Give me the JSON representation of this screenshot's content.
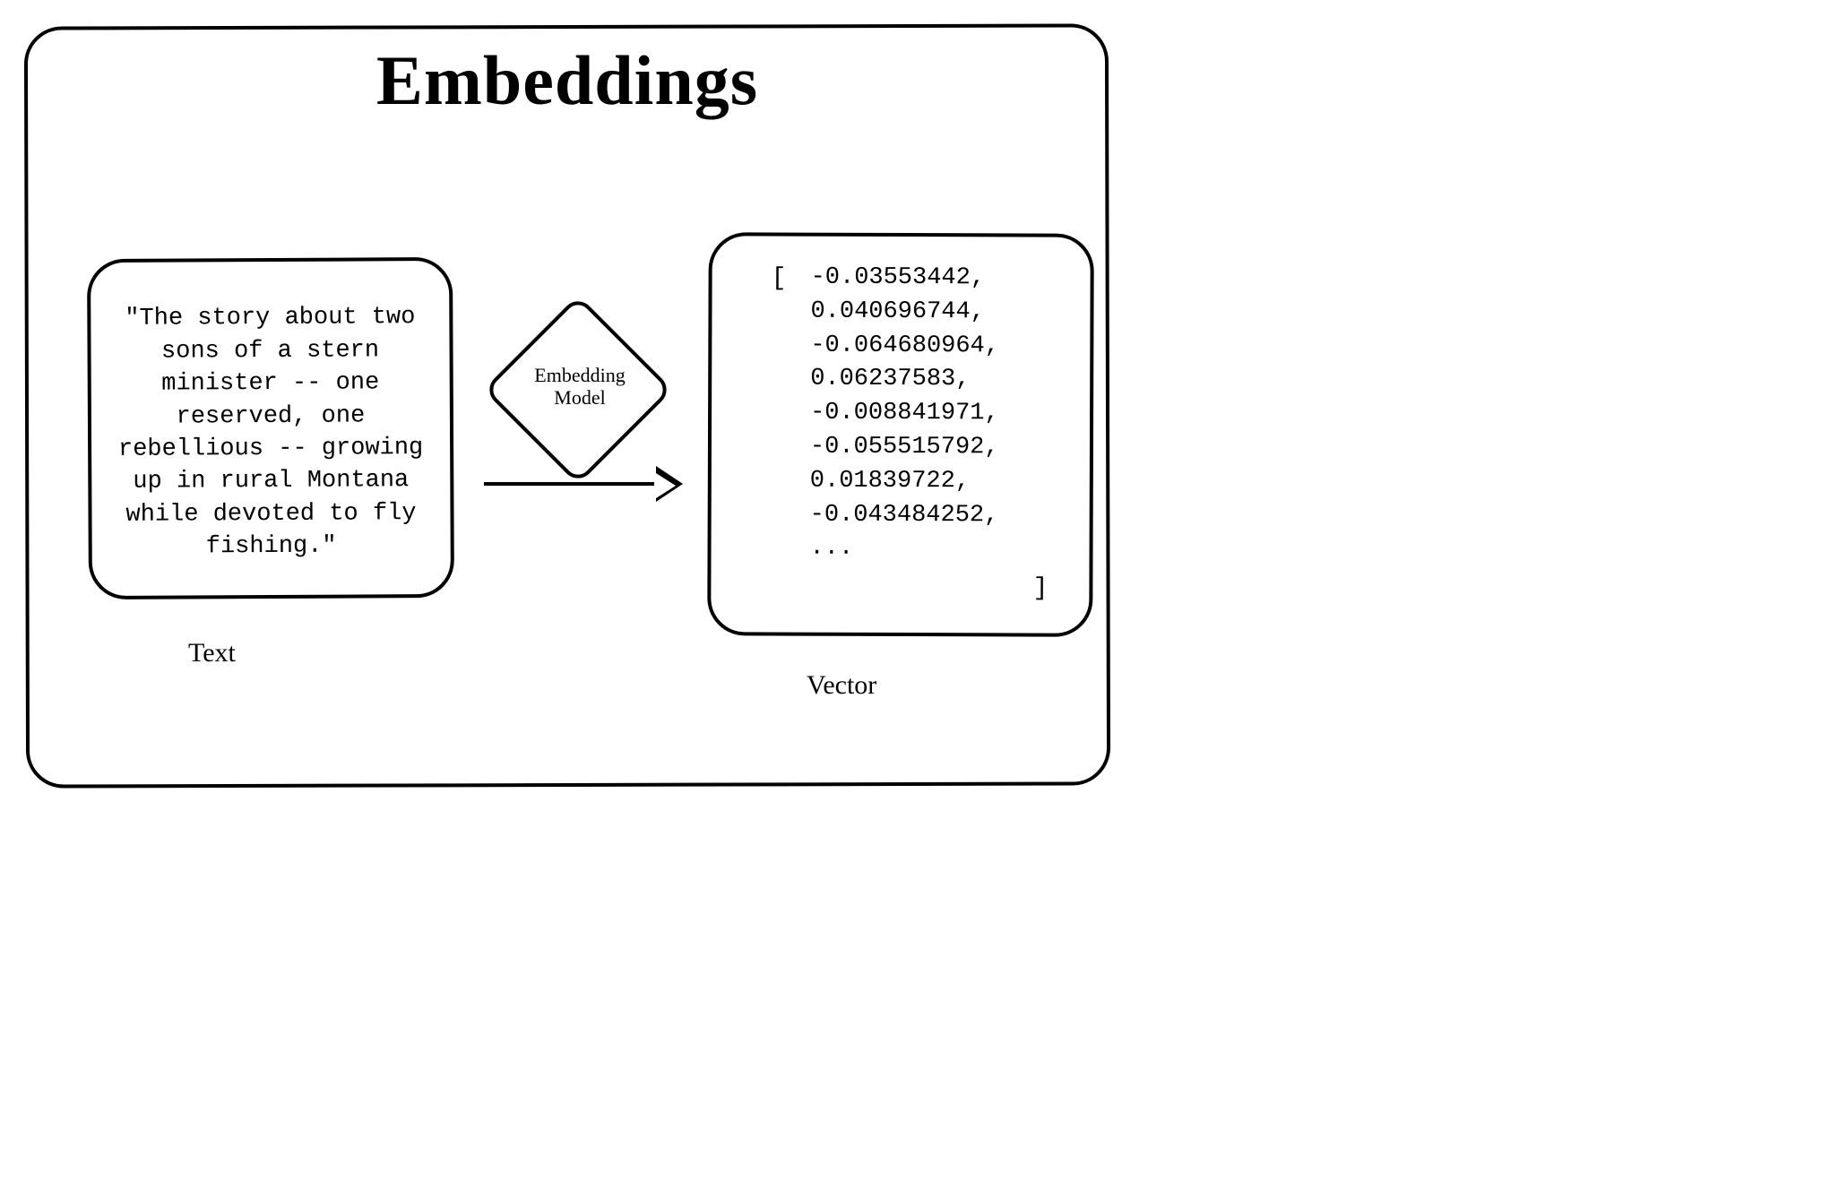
{
  "title": "Embeddings",
  "text_box": {
    "label": "Text",
    "content": "\"The story about two sons of a stern minister -- one reserved, one rebellious -- growing up in rural Montana while devoted to fly fishing.\""
  },
  "model_node": {
    "label_line1": "Embedding",
    "label_line2": "Model"
  },
  "vector_box": {
    "label": "Vector",
    "open_bracket": "[",
    "close_bracket": "]",
    "values": [
      "-0.03553442,",
      "0.040696744,",
      "-0.064680964,",
      "0.06237583,",
      "-0.008841971,",
      "-0.055515792,",
      "0.01839722,",
      "-0.043484252,",
      "..."
    ]
  }
}
